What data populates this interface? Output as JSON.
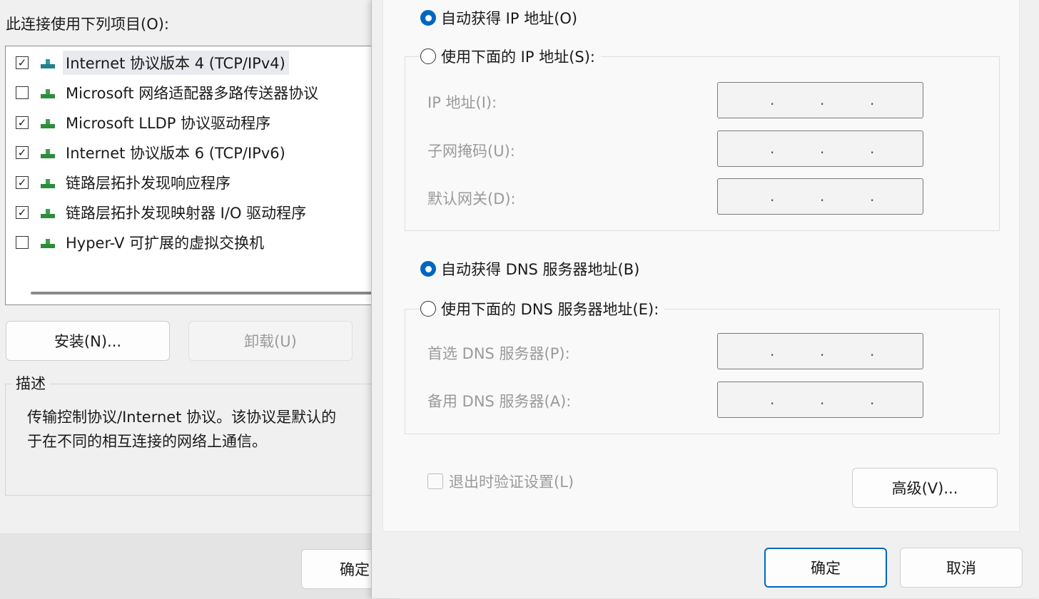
{
  "back_dialog": {
    "items_title": "此连接使用下列项目(O):",
    "items": [
      {
        "label": "Internet 协议版本 4 (TCP/IPv4)",
        "checked": true,
        "selected": true
      },
      {
        "label": "Microsoft 网络适配器多路传送器协议",
        "checked": false,
        "selected": false
      },
      {
        "label": "Microsoft LLDP 协议驱动程序",
        "checked": true,
        "selected": false
      },
      {
        "label": "Internet 协议版本 6 (TCP/IPv6)",
        "checked": true,
        "selected": false
      },
      {
        "label": "链路层拓扑发现响应程序",
        "checked": true,
        "selected": false
      },
      {
        "label": "链路层拓扑发现映射器 I/O 驱动程序",
        "checked": true,
        "selected": false
      },
      {
        "label": "Hyper-V 可扩展的虚拟交换机",
        "checked": false,
        "selected": false
      }
    ],
    "install_label": "安装(N)...",
    "uninstall_label": "卸载(U)",
    "description_legend": "描述",
    "description_line1": "传输控制协议/Internet 协议。该协议是默认的",
    "description_line2": "于在不同的相互连接的网络上通信。",
    "ok_label": "确定"
  },
  "front_dialog": {
    "auto_ip_label": "自动获得 IP 地址(O)",
    "manual_ip_label": "使用下面的 IP 地址(S):",
    "ip_address_label": "IP 地址(I):",
    "subnet_label": "子网掩码(U):",
    "gateway_label": "默认网关(D):",
    "auto_dns_label": "自动获得 DNS 服务器地址(B)",
    "manual_dns_label": "使用下面的 DNS 服务器地址(E):",
    "preferred_dns_label": "首选 DNS 服务器(P):",
    "alternate_dns_label": "备用 DNS 服务器(A):",
    "ip_separator": ".",
    "verify_label": "退出时验证设置(L)",
    "advanced_label": "高级(V)...",
    "ok_label": "确定",
    "cancel_label": "取消"
  },
  "colors": {
    "accent": "#0067c0",
    "disabled_text": "#9a9a9a"
  }
}
